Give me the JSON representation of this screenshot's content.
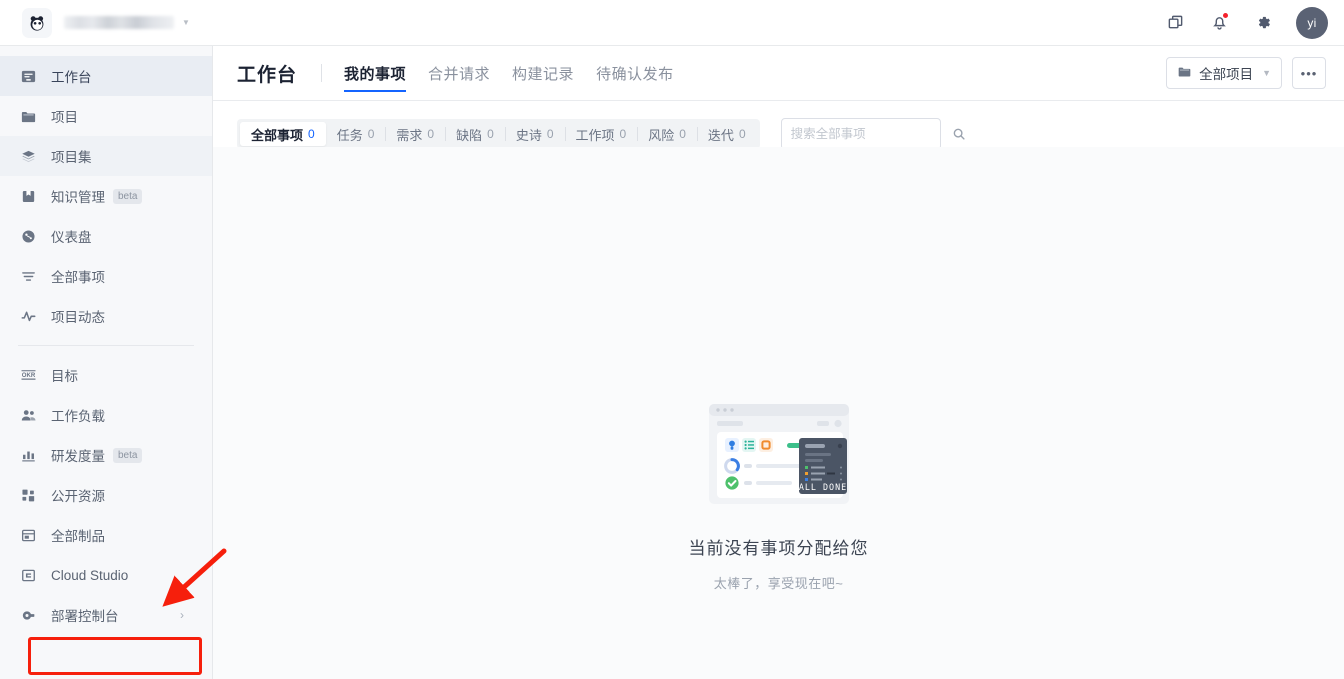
{
  "topbar": {
    "org_name_redacted": "",
    "logo_icon": "panda-logo-icon",
    "icons": [
      {
        "name": "copy-windows-icon",
        "label": "窗口"
      },
      {
        "name": "bell-notification-icon",
        "label": "通知"
      },
      {
        "name": "gear-settings-icon",
        "label": "设置"
      }
    ],
    "avatar_text": "yi"
  },
  "sidebar": {
    "items": [
      {
        "label": "工作台",
        "icon": "workbench-icon",
        "state": "active",
        "tag": "",
        "chevron": false
      },
      {
        "label": "项目",
        "icon": "folder-icon",
        "state": "",
        "tag": "",
        "chevron": false
      },
      {
        "label": "项目集",
        "icon": "layers-icon",
        "state": "hover",
        "tag": "",
        "chevron": false
      },
      {
        "label": "知识管理",
        "icon": "book-icon",
        "state": "",
        "tag": "beta",
        "chevron": false
      },
      {
        "label": "仪表盘",
        "icon": "dashboard-icon",
        "state": "",
        "tag": "",
        "chevron": false
      },
      {
        "label": "全部事项",
        "icon": "filter-list-icon",
        "state": "",
        "tag": "",
        "chevron": false
      },
      {
        "label": "项目动态",
        "icon": "activity-pulse-icon",
        "state": "",
        "tag": "",
        "chevron": false
      }
    ],
    "items2": [
      {
        "label": "目标",
        "icon": "okr-icon",
        "state": "",
        "tag": "",
        "chevron": false
      },
      {
        "label": "工作负载",
        "icon": "users-icon",
        "state": "",
        "tag": "",
        "chevron": false
      },
      {
        "label": "研发度量",
        "icon": "bar-chart-icon",
        "state": "",
        "tag": "beta",
        "chevron": false
      },
      {
        "label": "公开资源",
        "icon": "grid-squares-icon",
        "state": "",
        "tag": "",
        "chevron": false
      },
      {
        "label": "全部制品",
        "icon": "artifact-box-icon",
        "state": "",
        "tag": "",
        "chevron": false
      },
      {
        "label": "Cloud Studio",
        "icon": "cloud-studio-icon",
        "state": "",
        "tag": "",
        "chevron": false
      },
      {
        "label": "部署控制台",
        "icon": "deploy-console-icon",
        "state": "",
        "tag": "",
        "chevron": true
      }
    ]
  },
  "annotation": {
    "highlight_color": "#f61f0c",
    "target_label": "部署控制台"
  },
  "header": {
    "title": "工作台",
    "tabs": [
      {
        "label": "我的事项",
        "active": true
      },
      {
        "label": "合并请求",
        "active": false
      },
      {
        "label": "构建记录",
        "active": false
      },
      {
        "label": "待确认发布",
        "active": false
      }
    ],
    "project_select": {
      "label": "全部项目",
      "icon": "folder-icon"
    },
    "more_button": {
      "label": "•••",
      "name": "more-options-button"
    }
  },
  "filters": {
    "chips": [
      {
        "label": "全部事项",
        "count": "0",
        "active": true
      },
      {
        "label": "任务",
        "count": "0",
        "active": false
      },
      {
        "label": "需求",
        "count": "0",
        "active": false
      },
      {
        "label": "缺陷",
        "count": "0",
        "active": false
      },
      {
        "label": "史诗",
        "count": "0",
        "active": false
      },
      {
        "label": "工作项",
        "count": "0",
        "active": false
      },
      {
        "label": "风险",
        "count": "0",
        "active": false
      },
      {
        "label": "迭代",
        "count": "0",
        "active": false
      }
    ],
    "search": {
      "value": "",
      "placeholder": "搜索全部事项",
      "icon": "search-icon"
    }
  },
  "empty_state": {
    "illustration": "all-done-illustration",
    "illustration_text": "ALL DONE",
    "title": "当前没有事项分配给您",
    "subtitle": "太棒了，享受现在吧~"
  },
  "colors": {
    "accent": "#1464ff",
    "sidebar_bg": "#f7f8fa",
    "annotation_red": "#f61f0c",
    "badge_red": "#f5222d",
    "success_green": "#52c41a"
  }
}
